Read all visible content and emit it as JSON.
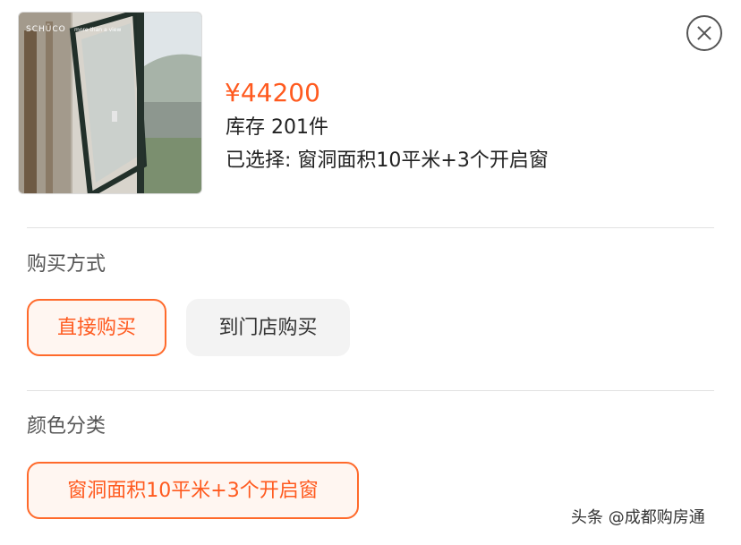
{
  "product": {
    "image_brand_text": "SCHÜCO",
    "image_slogan_text": "more than a view",
    "price": "¥44200",
    "stock": "库存 201件",
    "selected": "已选择: 窗洞面积10平米+3个开启窗"
  },
  "purchase_method": {
    "title": "购买方式",
    "options": [
      "直接购买",
      "到门店购买"
    ],
    "selected_index": 0
  },
  "color_category": {
    "title": "颜色分类",
    "options": [
      "窗洞面积10平米+3个开启窗"
    ],
    "selected_index": 0
  },
  "watermark": "头条 @成都购房通",
  "colors": {
    "accent": "#ff5a1f",
    "accent_border": "#ff6a2b",
    "inactive_bg": "#f3f3f3"
  },
  "icons": {
    "close": "close-icon"
  }
}
